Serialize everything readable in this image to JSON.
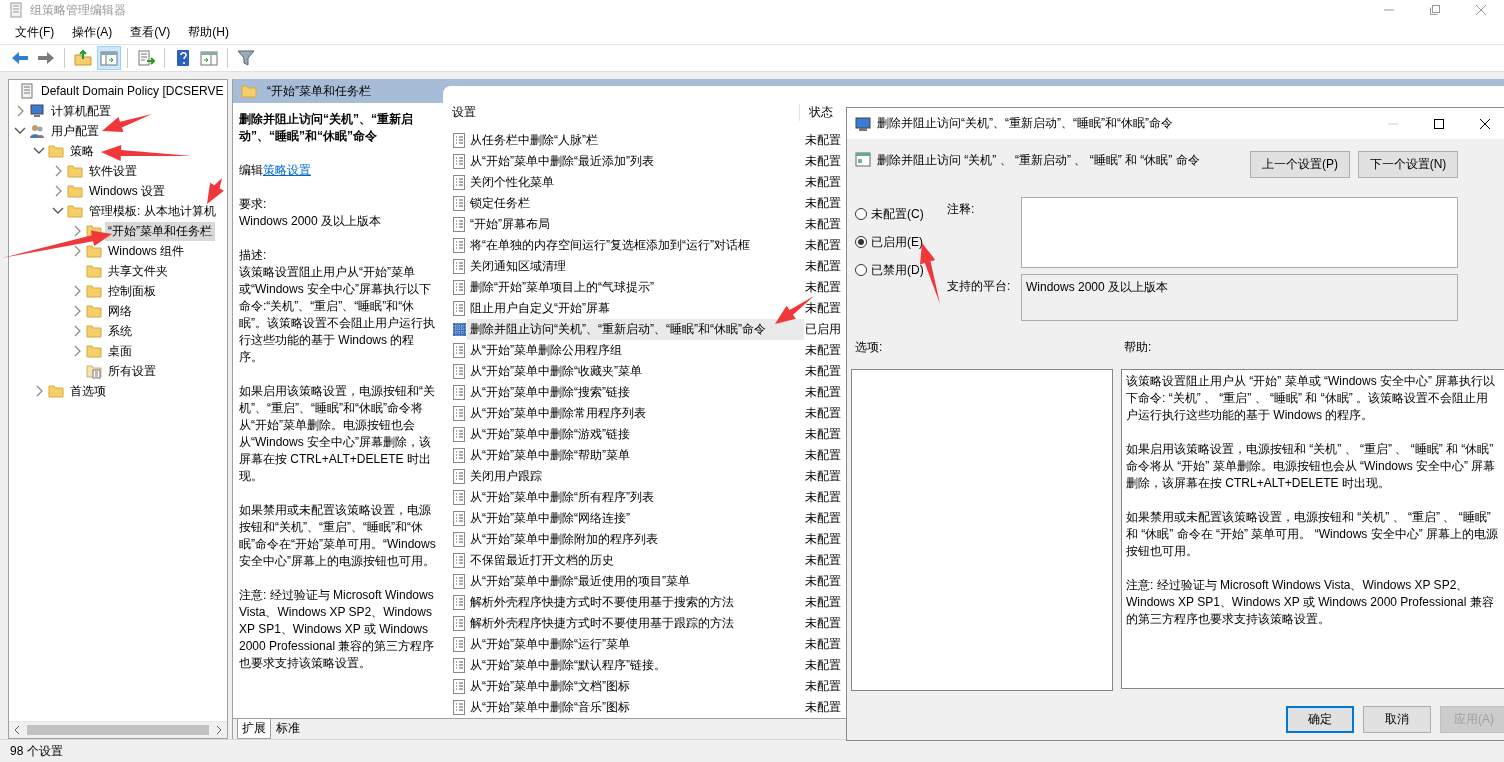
{
  "window": {
    "title": "组策略管理编辑器"
  },
  "menu": [
    "文件(F)",
    "操作(A)",
    "查看(V)",
    "帮助(H)"
  ],
  "toolbar": [
    {
      "kind": "back",
      "pressed": false
    },
    {
      "kind": "forward",
      "pressed": false
    },
    {
      "kind": "separator"
    },
    {
      "kind": "up",
      "pressed": false
    },
    {
      "kind": "tree",
      "pressed": true
    },
    {
      "kind": "separator"
    },
    {
      "kind": "export",
      "pressed": false
    },
    {
      "kind": "separator"
    },
    {
      "kind": "help",
      "pressed": false
    },
    {
      "kind": "properties",
      "pressed": false
    },
    {
      "kind": "separator"
    },
    {
      "kind": "filter",
      "pressed": false
    }
  ],
  "tree": {
    "label": "Default Domain Policy [DCSERVE",
    "kind": "policy",
    "selected": false,
    "children": [
      {
        "label": "计算机配置",
        "kind": "computer",
        "expanded": false,
        "selected": false
      },
      {
        "label": "用户配置",
        "kind": "users",
        "expanded": true,
        "selected": false,
        "children": [
          {
            "label": "策略",
            "kind": "folder",
            "expanded": true,
            "selected": false,
            "children": [
              {
                "label": "软件设置",
                "kind": "folder",
                "expanded": false,
                "selected": false
              },
              {
                "label": "Windows 设置",
                "kind": "folder",
                "expanded": false,
                "selected": false
              },
              {
                "label": "管理模板: 从本地计算机",
                "kind": "folder",
                "expanded": true,
                "selected": false,
                "children": [
                  {
                    "label": "“开始”菜单和任务栏",
                    "kind": "folder",
                    "expanded": false,
                    "selected": true
                  },
                  {
                    "label": "Windows 组件",
                    "kind": "folder",
                    "expanded": false,
                    "selected": false
                  },
                  {
                    "label": "共享文件夹",
                    "kind": "folder",
                    "selected": false
                  },
                  {
                    "label": "控制面板",
                    "kind": "folder",
                    "expanded": false,
                    "selected": false
                  },
                  {
                    "label": "网络",
                    "kind": "folder",
                    "expanded": false,
                    "selected": false
                  },
                  {
                    "label": "系统",
                    "kind": "folder",
                    "expanded": false,
                    "selected": false
                  },
                  {
                    "label": "桌面",
                    "kind": "folder",
                    "expanded": false,
                    "selected": false
                  },
                  {
                    "label": "所有设置",
                    "kind": "all-settings",
                    "selected": false
                  }
                ]
              }
            ]
          },
          {
            "label": "首选项",
            "kind": "folder",
            "expanded": false,
            "selected": false
          }
        ]
      }
    ]
  },
  "pane": {
    "title": "“开始”菜单和任务栏"
  },
  "description": {
    "title": "删除并阻止访问“关机”、“重新启动”、“睡眠”和“休眠”命令",
    "edit_prefix": "编辑",
    "edit_link": "策略设置",
    "requirement_label": "要求:",
    "requirement": "Windows 2000 及以上版本",
    "description_label": "描述:",
    "paragraphs": [
      "该策略设置阻止用户从“开始”菜单或“Windows 安全中心”屏幕执行以下命令:“关机”、“重启”、“睡眠”和“休眠”。该策略设置不会阻止用户运行执行这些功能的基于 Windows 的程序。",
      "如果启用该策略设置，电源按钮和“关机”、“重启”、“睡眠”和“休眠”命令将从“开始”菜单删除。电源按钮也会从“Windows 安全中心”屏幕删除，该屏幕在按 CTRL+ALT+DELETE 时出现。",
      "如果禁用或未配置该策略设置，电源按钮和“关机”、“重启”、“睡眠”和“休眠”命令在“开始”菜单可用。“Windows 安全中心”屏幕上的电源按钮也可用。",
      "注意: 经过验证与 Microsoft Windows Vista、Windows XP SP2、Windows XP SP1、Windows XP 或 Windows 2000 Professional 兼容的第三方程序也要求支持该策略设置。"
    ]
  },
  "list": {
    "columns": [
      "设置",
      "状态"
    ],
    "rows": [
      {
        "name": "从任务栏中删除“人脉”栏",
        "state": "未配置",
        "selected": false
      },
      {
        "name": "从“开始”菜单中删除“最近添加”列表",
        "state": "未配置",
        "selected": false
      },
      {
        "name": "关闭个性化菜单",
        "state": "未配置",
        "selected": false
      },
      {
        "name": "锁定任务栏",
        "state": "未配置",
        "selected": false
      },
      {
        "name": "“开始”屏幕布局",
        "state": "未配置",
        "selected": false
      },
      {
        "name": "将“在单独的内存空间运行”复选框添加到“运行”对话框",
        "state": "未配置",
        "selected": false
      },
      {
        "name": "关闭通知区域清理",
        "state": "未配置",
        "selected": false
      },
      {
        "name": "删除“开始”菜单项目上的“气球提示”",
        "state": "未配置",
        "selected": false
      },
      {
        "name": "阻止用户自定义“开始”屏幕",
        "state": "未配置",
        "selected": false
      },
      {
        "name": "删除并阻止访问“关机”、“重新启动”、“睡眠”和“休眠”命令",
        "state": "已启用",
        "selected": true
      },
      {
        "name": "从“开始”菜单删除公用程序组",
        "state": "未配置",
        "selected": false
      },
      {
        "name": "从“开始”菜单中删除“收藏夹”菜单",
        "state": "未配置",
        "selected": false
      },
      {
        "name": "从“开始”菜单中删除“搜索”链接",
        "state": "未配置",
        "selected": false
      },
      {
        "name": "从“开始”菜单中删除常用程序列表",
        "state": "未配置",
        "selected": false
      },
      {
        "name": "从“开始”菜单中删除“游戏”链接",
        "state": "未配置",
        "selected": false
      },
      {
        "name": "从“开始”菜单中删除“帮助”菜单",
        "state": "未配置",
        "selected": false
      },
      {
        "name": "关闭用户跟踪",
        "state": "未配置",
        "selected": false
      },
      {
        "name": "从“开始”菜单中删除“所有程序”列表",
        "state": "未配置",
        "selected": false
      },
      {
        "name": "从“开始”菜单中删除“网络连接”",
        "state": "未配置",
        "selected": false
      },
      {
        "name": "从“开始”菜单中删除附加的程序列表",
        "state": "未配置",
        "selected": false
      },
      {
        "name": "不保留最近打开文档的历史",
        "state": "未配置",
        "selected": false
      },
      {
        "name": "从“开始”菜单中删除“最近使用的项目”菜单",
        "state": "未配置",
        "selected": false
      },
      {
        "name": "解析外壳程序快捷方式时不要使用基于搜索的方法",
        "state": "未配置",
        "selected": false
      },
      {
        "name": "解析外壳程序快捷方式时不要使用基于跟踪的方法",
        "state": "未配置",
        "selected": false
      },
      {
        "name": "从“开始”菜单中删除“运行”菜单",
        "state": "未配置",
        "selected": false
      },
      {
        "name": "从“开始”菜单中删除“默认程序”链接。",
        "state": "未配置",
        "selected": false
      },
      {
        "name": "从“开始”菜单中删除“文档”图标",
        "state": "未配置",
        "selected": false
      },
      {
        "name": "从“开始”菜单中删除“音乐”图标",
        "state": "未配置",
        "selected": false
      }
    ]
  },
  "tabs": [
    {
      "label": "扩展",
      "selected": true
    },
    {
      "label": "标准",
      "selected": false
    }
  ],
  "status_bar": "98 个设置",
  "dialog": {
    "title": "删除并阻止访问“关机”、“重新启动”、“睡眠”和“休眠”命令",
    "heading": "删除并阻止访问 “关机” 、 “重新启动” 、 “睡眠” 和 “休眠” 命令",
    "nav_buttons": [
      "上一个设置(P)",
      "下一个设置(N)"
    ],
    "options": [
      {
        "label": "未配置(C)",
        "selected": false
      },
      {
        "label": "已启用(E)",
        "selected": true
      },
      {
        "label": "已禁用(D)",
        "selected": false
      }
    ],
    "comment_label": "注释:",
    "platform_label": "支持的平台:",
    "platform": "Windows 2000 及以上版本",
    "options_label": "选项:",
    "help_label": "帮助:",
    "help": [
      "该策略设置阻止用户从 “开始” 菜单或 “Windows 安全中心” 屏幕执行以下命令: “关机” 、 “重启” 、 “睡眠” 和 “休眠” 。该策略设置不会阻止用户运行执行这些功能的基于 Windows 的程序。",
      "如果启用该策略设置，电源按钮和 “关机” 、 “重启” 、 “睡眠” 和 “休眠” 命令将从 “开始” 菜单删除。电源按钮也会从 “Windows 安全中心” 屏幕删除，该屏幕在按 CTRL+ALT+DELETE 时出现。",
      "如果禁用或未配置该策略设置，电源按钮和 “关机” 、 “重启” 、 “睡眠” 和 “休眠” 命令在 “开始” 菜单可用。 “Windows 安全中心” 屏幕上的电源按钮也可用。",
      "注意: 经过验证与 Microsoft Windows Vista、Windows XP SP2、Windows XP SP1、Windows XP 或 Windows 2000 Professional 兼容的第三方程序也要求支持该策略设置。"
    ],
    "buttons": [
      {
        "label": "确定",
        "disabled": false,
        "default": true
      },
      {
        "label": "取消",
        "disabled": false,
        "default": false
      },
      {
        "label": "应用(A)",
        "disabled": true,
        "default": false
      }
    ]
  }
}
